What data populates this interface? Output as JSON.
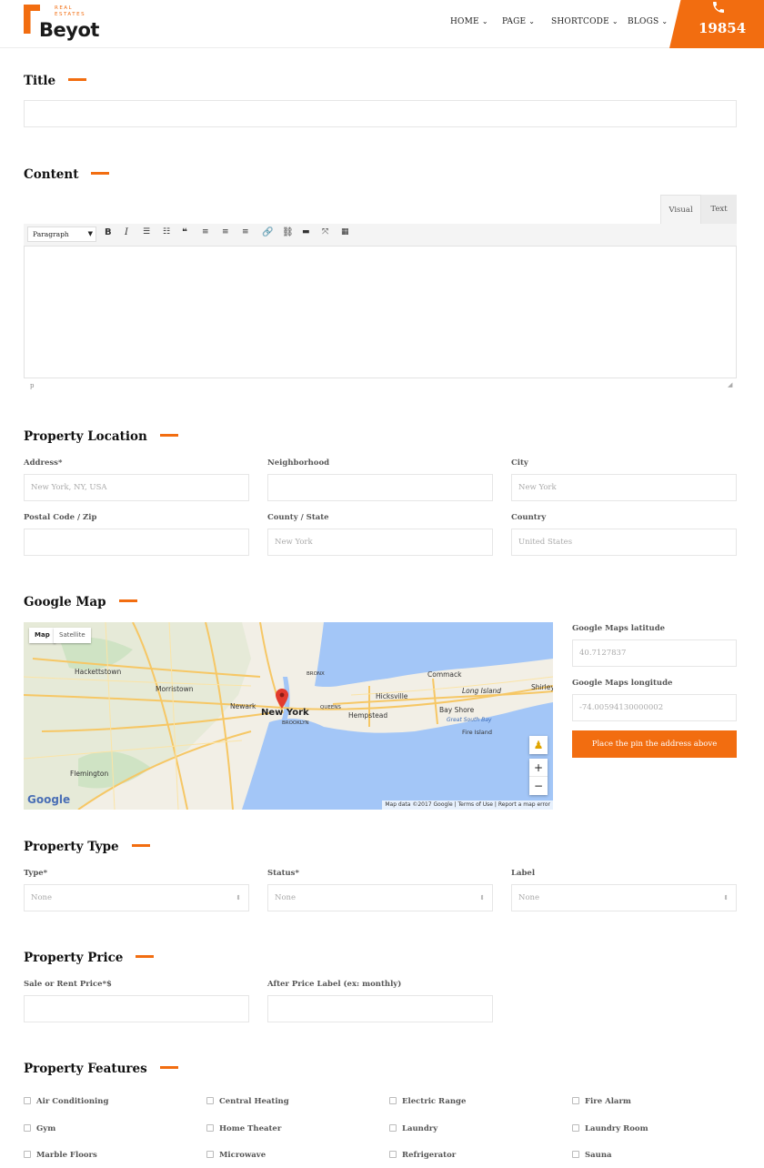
{
  "header": {
    "logo_sub": "REAL ESTATES",
    "logo_name": "Beyot",
    "nav": [
      {
        "label": "HOME"
      },
      {
        "label": "PAGE"
      },
      {
        "label": "SHORTCODE"
      },
      {
        "label": "BLOGS"
      }
    ],
    "phone_number": "19854",
    "accent_color": "#f26d10"
  },
  "title_section": {
    "heading": "Title",
    "value": ""
  },
  "content_section": {
    "heading": "Content",
    "tabs": {
      "visual": "Visual",
      "text": "Text"
    },
    "format_select": "Paragraph",
    "toolbar_icons": [
      "bold-icon",
      "italic-icon",
      "bullet-list-icon",
      "numbered-list-icon",
      "blockquote-icon",
      "align-left-icon",
      "align-center-icon",
      "align-right-icon",
      "link-icon",
      "unlink-icon",
      "read-more-icon",
      "fullscreen-icon",
      "toolbar-toggle-icon"
    ],
    "path_label": "p"
  },
  "location": {
    "heading": "Property Location",
    "address_label": "Address*",
    "address_placeholder": "New York, NY, USA",
    "neighborhood_label": "Neighborhood",
    "neighborhood_placeholder": "",
    "city_label": "City",
    "city_placeholder": "New York",
    "zip_label": "Postal Code / Zip",
    "zip_placeholder": "",
    "state_label": "County / State",
    "state_placeholder": "New York",
    "country_label": "Country",
    "country_placeholder": "United States"
  },
  "google_map": {
    "heading": "Google Map",
    "map_tab": "Map",
    "satellite_tab": "Satellite",
    "places": [
      "Hackettstown",
      "Morristown",
      "Newark",
      "New York",
      "BRONX",
      "Commack",
      "Long Island",
      "Shirley",
      "Hicksville",
      "Hempstead",
      "Bay Shore",
      "Fire Island",
      "Great South Bay",
      "QUEENS",
      "BROOKLYN",
      "Flemington"
    ],
    "google_logo": "Google",
    "attribution": [
      "Map data ©2017 Google",
      "Terms of Use",
      "Report a map error"
    ],
    "zoom_in": "+",
    "zoom_out": "−",
    "lat_label": "Google Maps latitude",
    "lat_placeholder": "40.7127837",
    "lng_label": "Google Maps longitude",
    "lng_placeholder": "-74.00594130000002",
    "pin_button": "Place the pin the address above"
  },
  "property_type": {
    "heading": "Property Type",
    "type_label": "Type*",
    "type_value": "None",
    "status_label": "Status*",
    "status_value": "None",
    "label_label": "Label",
    "label_value": "None"
  },
  "property_price": {
    "heading": "Property Price",
    "price_label": "Sale or Rent Price*$",
    "after_label": "After Price Label (ex: monthly)"
  },
  "features": {
    "heading": "Property Features",
    "items": [
      "Air Conditioning",
      "Central Heating",
      "Electric Range",
      "Fire Alarm",
      "Gym",
      "Home Theater",
      "Laundry",
      "Laundry Room",
      "Marble Floors",
      "Microwave",
      "Refrigerator",
      "Sauna"
    ]
  }
}
